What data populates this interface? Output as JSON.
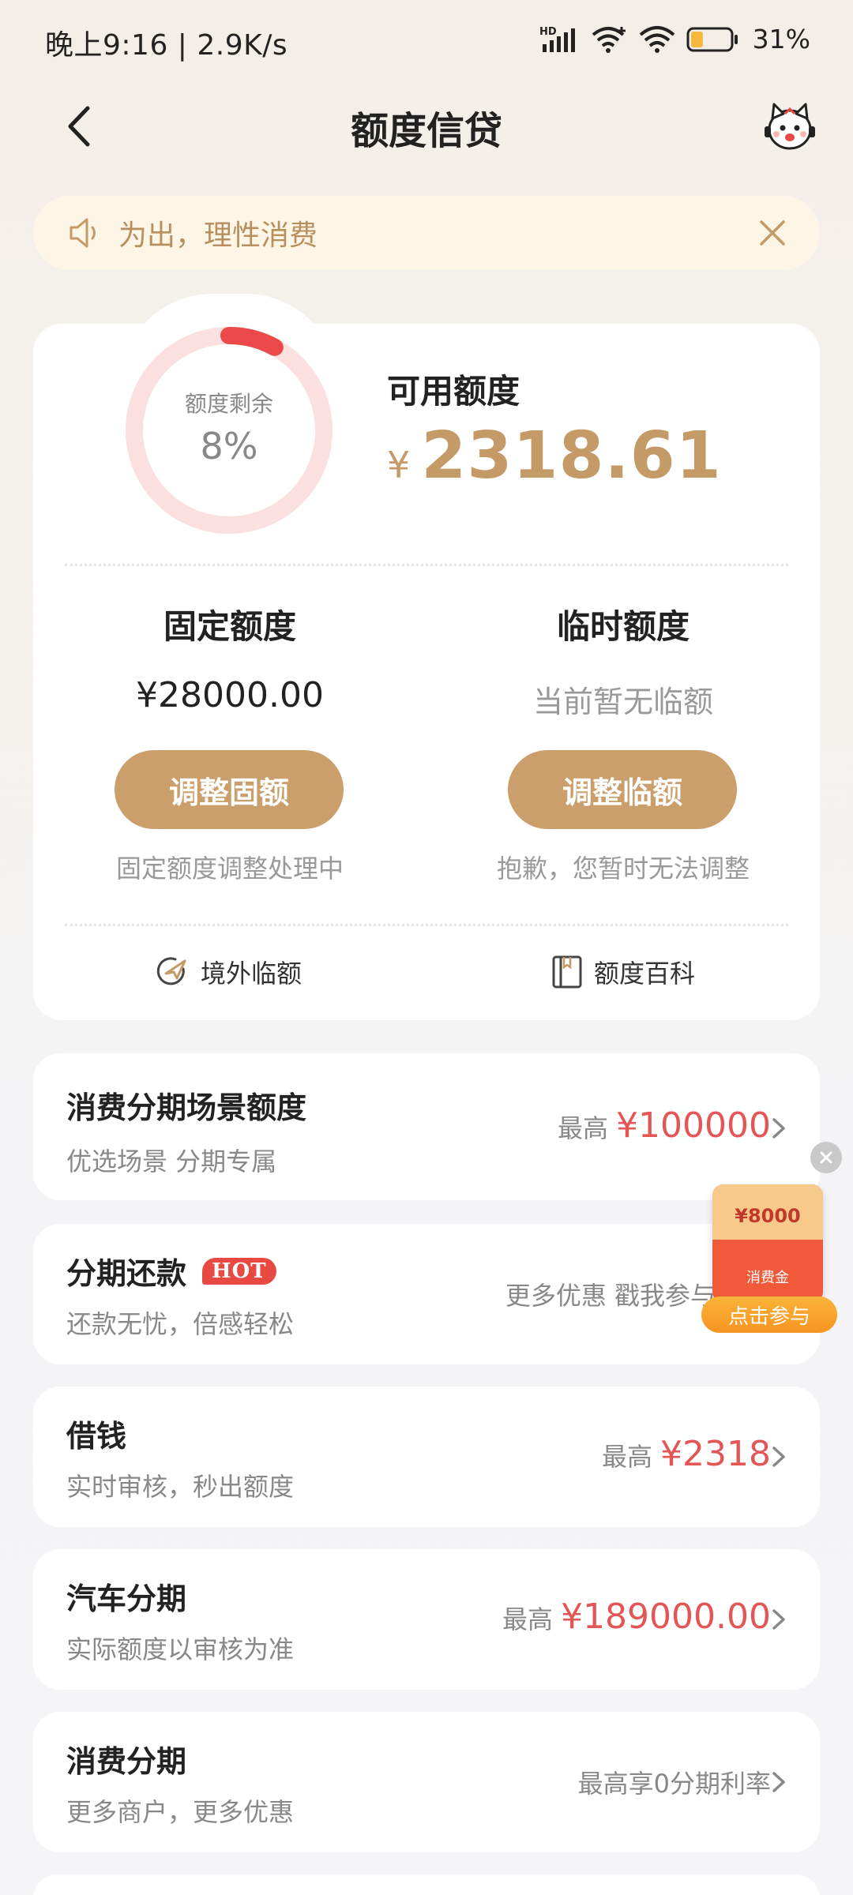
{
  "status_bar": {
    "time": "晚上9:16 | 2.9K/s",
    "network": "HD",
    "battery": "31%",
    "battery_level_percent": 31
  },
  "nav": {
    "title": "额度信贷"
  },
  "notice": {
    "text": "为出，理性消费"
  },
  "credit": {
    "gauge_label": "额度剩余",
    "gauge_percent_text": "8%",
    "gauge_fraction": 0.08,
    "available_label": "可用额度",
    "available_currency": "¥",
    "available_value": "2318.61",
    "fixed": {
      "title": "固定额度",
      "amount": "¥28000.00",
      "button": "调整固额",
      "note": "固定额度调整处理中"
    },
    "temporary": {
      "title": "临时额度",
      "amount": "当前暂无临额",
      "button": "调整临额",
      "note": "抱歉，您暂时无法调整"
    },
    "shortcuts": {
      "overseas": "境外临额",
      "encyclopedia": "额度百科"
    }
  },
  "items": [
    {
      "title": "消费分期场景额度",
      "subtitle": "优选场景 分期专属",
      "prefix": "最高",
      "value": "¥100000"
    },
    {
      "title": "分期还款",
      "badge": "HOT",
      "subtitle": "还款无忧，倍感轻松",
      "right_text": "更多优惠 戳我参与"
    },
    {
      "title": "借钱",
      "subtitle": "实时审核，秒出额度",
      "prefix": "最高",
      "value": "¥2318"
    },
    {
      "title": "汽车分期",
      "subtitle": "实际额度以审核为准",
      "prefix": "最高",
      "value": "¥189000.00"
    },
    {
      "title": "消费分期",
      "subtitle": "更多商户，更多优惠",
      "right_text": "最高享0分期利率"
    }
  ],
  "promo": {
    "amount": "¥8000",
    "label": "消费金",
    "button": "点击参与"
  },
  "colors": {
    "accent_gold": "#cb9f6c",
    "amount_gold": "#c49a67",
    "highlight_red": "#e45656",
    "gauge_track": "#fbe0df",
    "gauge_fill": "#ec4a4a"
  }
}
